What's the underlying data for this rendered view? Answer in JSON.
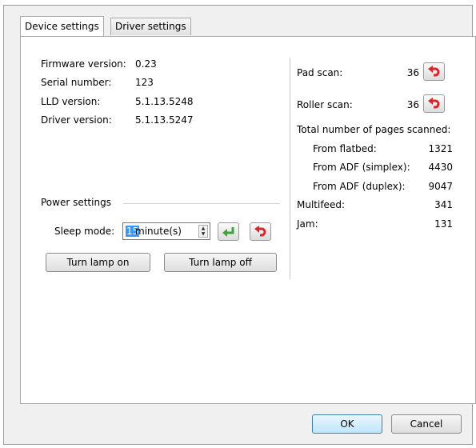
{
  "tabs": [
    {
      "label": "Device settings"
    },
    {
      "label": "Driver settings"
    }
  ],
  "device_info": {
    "firmware_label": "Firmware version:",
    "firmware_value": "0.23",
    "serial_label": "Serial number:",
    "serial_value": "123",
    "lld_label": "LLD version:",
    "lld_value": "5.1.13.5248",
    "driver_label": "Driver version:",
    "driver_value": "5.1.13.5247"
  },
  "power": {
    "group_label": "Power settings",
    "sleep_label": "Sleep mode:",
    "sleep_value": "15",
    "sleep_unit": "minute(s)",
    "lamp_on_label": "Turn lamp on",
    "lamp_off_label": "Turn lamp off"
  },
  "counters": {
    "pad_label": "Pad scan:",
    "pad_value": "36",
    "roller_label": "Roller scan:",
    "roller_value": "36",
    "total_label": "Total number of pages scanned:",
    "flatbed_label": "From flatbed:",
    "flatbed_value": "1321",
    "adf_simplex_label": "From ADF (simplex):",
    "adf_simplex_value": "4430",
    "adf_duplex_label": "From ADF (duplex):",
    "adf_duplex_value": "9047",
    "multifeed_label": "Multifeed:",
    "multifeed_value": "341",
    "jam_label": "Jam:",
    "jam_value": "131"
  },
  "footer": {
    "ok_label": "OK",
    "cancel_label": "Cancel"
  },
  "colors": {
    "reset_icon": "#d9262b",
    "apply_icon": "#3aa43a",
    "selection": "#3399ff"
  },
  "icons": {
    "reset": "undo-arrow-icon",
    "apply": "enter-arrow-icon"
  }
}
